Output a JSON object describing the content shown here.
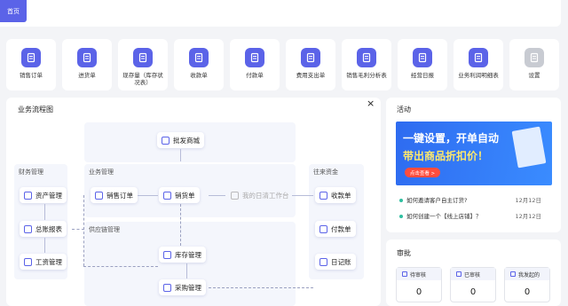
{
  "tab": {
    "home": "首页"
  },
  "shortcuts": [
    {
      "label": "销售订单",
      "icon": "order-icon"
    },
    {
      "label": "进货单",
      "icon": "purchase-icon"
    },
    {
      "label": "现存量（库存状况表）",
      "icon": "stock-icon"
    },
    {
      "label": "收款单",
      "icon": "receipt-icon"
    },
    {
      "label": "付款单",
      "icon": "payment-icon"
    },
    {
      "label": "费用支出单",
      "icon": "expense-icon"
    },
    {
      "label": "销售毛利分析表",
      "icon": "analysis-icon"
    },
    {
      "label": "经营日报",
      "icon": "daily-icon"
    },
    {
      "label": "业务利润明细表",
      "icon": "profit-icon"
    },
    {
      "label": "设置",
      "icon": "gear-icon"
    }
  ],
  "flow": {
    "title": "业务流程图",
    "close": "×",
    "regions": {
      "finance": "财务管理",
      "business": "业务管理",
      "supply": "供应链管理",
      "funds": "往来资金"
    },
    "nodes": {
      "wholesale": "批发商城",
      "assets": "资产管理",
      "ledger": "总账报表",
      "payroll": "工资管理",
      "sales_order": "销售订单",
      "sales_doc": "销货单",
      "workbench": "我的日清工作台",
      "receipt": "收款单",
      "payment": "付款单",
      "journal": "日记账",
      "inventory": "库存管理",
      "procurement": "采购管理"
    }
  },
  "activity": {
    "title": "活动",
    "banner_line1": "一键设置，开单自动",
    "banner_line2": "带出商品折扣价！",
    "banner_button": "点击查看 >",
    "news": [
      {
        "text": "如何邀请客户自主订货?",
        "date": "12月12日"
      },
      {
        "text": "如何创建一个【线上店铺】？",
        "date": "12月12日"
      }
    ]
  },
  "approval": {
    "title": "审批",
    "cards": [
      {
        "label": "待审核",
        "value": "0"
      },
      {
        "label": "已审核",
        "value": "0"
      },
      {
        "label": "我发起的",
        "value": "0"
      }
    ]
  },
  "colors": {
    "accent": "#5b63e8",
    "background": "#f3f4f7"
  }
}
